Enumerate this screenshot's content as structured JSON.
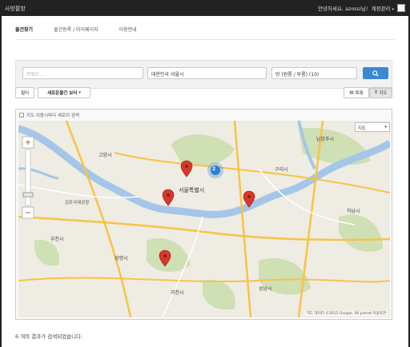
{
  "header": {
    "brand": "사방팔방",
    "greeting": "안녕하세요, azossi님!",
    "account_menu": "계정관리"
  },
  "tabs": [
    {
      "label": "물건찾기"
    },
    {
      "label": "물건등록 / 마이페이지"
    },
    {
      "label": "이용안내"
    }
  ],
  "search": {
    "keyword_placeholder": "키워드...",
    "location_value": "대한민국 서울시",
    "room_type_value": "방 (원룸 / 투룸) (10)"
  },
  "toolbar": {
    "filter_label": "필터",
    "new_listing_label": "새로운물건 보티",
    "list_view_label": "목록",
    "map_view_label": "지도"
  },
  "map": {
    "move_search_label": "지도 이동시마다 새로이 검색",
    "map_type_label": "지도",
    "cluster_count": "2",
    "attribution": "지도 데이터 ©2015 Google, SK planet  이용약관",
    "place_labels": {
      "seoul": "서울특별시",
      "guri": "구리시",
      "namyangju": "남양주시",
      "hanam": "하남시",
      "bucheon": "부천시",
      "gwangmyeong": "광명시",
      "goyang": "고양시",
      "gimpo_airport": "김포국제공항",
      "gwacheon": "과천시",
      "seongnam": "성남시"
    },
    "colors": {
      "water": "#a4c6e8",
      "land": "#efece3",
      "green": "#cfe0b4",
      "road": "#f6c447",
      "marker": "#d8382c",
      "cluster": "#2f7ed8"
    }
  },
  "results": {
    "summary": "6 개의 결과가 검색되었습니다."
  }
}
